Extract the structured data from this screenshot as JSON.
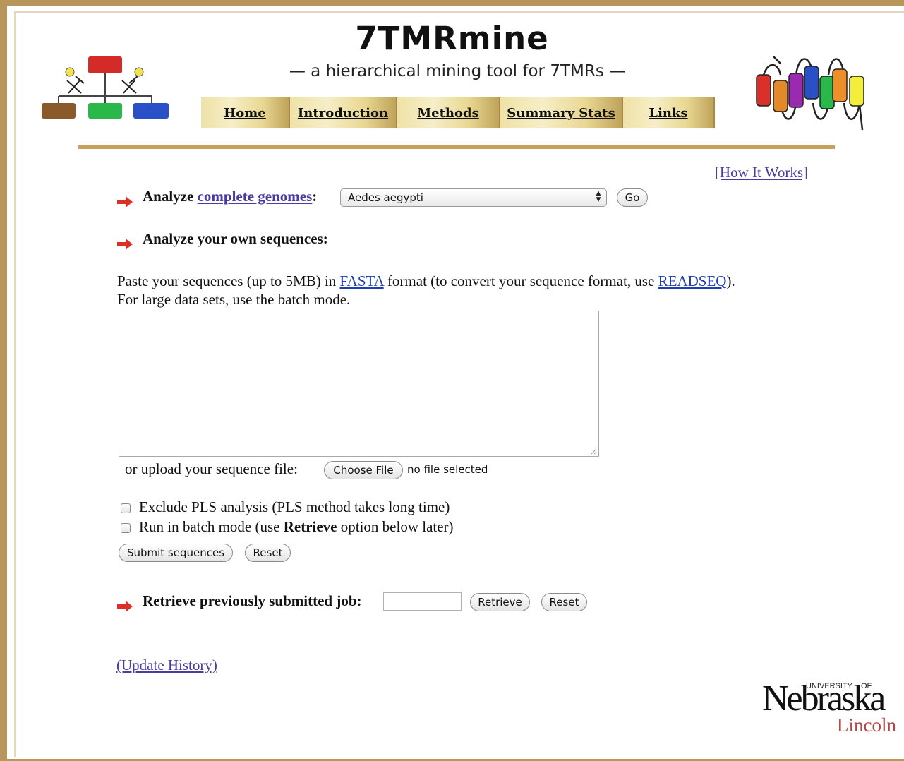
{
  "header": {
    "title": "7TMRmine",
    "subtitle": "— a hierarchical mining tool for 7TMRs —"
  },
  "nav": {
    "tabs": [
      {
        "label": "Home"
      },
      {
        "label": "Introduction"
      },
      {
        "label": "Methods"
      },
      {
        "label": "Summary Stats"
      },
      {
        "label": "Links"
      }
    ]
  },
  "how_it_works": "[How It Works]",
  "genomes": {
    "label_prefix": "Analyze ",
    "label_link": "complete genomes",
    "label_suffix": ":",
    "selected": "Aedes aegypti",
    "go_button": "Go"
  },
  "own_sequences": {
    "heading": "Analyze your own sequences:",
    "line1_a": "Paste your sequences (up to 5MB) in ",
    "fasta_link": "FASTA",
    "line1_b": " format (to convert your sequence format, use ",
    "readseq_link": "READSEQ",
    "line1_c": ").",
    "line2": "For large data sets, use the batch mode.",
    "textarea_value": "",
    "upload_label": "or upload your sequence file:",
    "choose_file_button": "Choose File",
    "no_file_text": "no file selected",
    "exclude_pls_label": "Exclude PLS analysis (PLS method takes long time)",
    "batch_label_a": "Run in batch mode (use ",
    "batch_label_bold": "Retrieve",
    "batch_label_b": " option below later)",
    "submit_button": "Submit sequences",
    "reset_button": "Reset"
  },
  "retrieve": {
    "label": "Retrieve previously submitted job:",
    "input_value": "",
    "retrieve_button": "Retrieve",
    "reset_button": "Reset"
  },
  "update_history": "(Update History)",
  "university_logo": {
    "university": "UNIVERSITY",
    "of": "OF",
    "name": "Nebraska",
    "campus": "Lincoln"
  },
  "colors": {
    "frame": "#b8955a",
    "link_purple": "#4b3aa0",
    "link_blue": "#1f3fb0",
    "arrow_red": "#d9312a",
    "lincoln_red": "#b8424a"
  },
  "icons": {
    "left_logo": "hierarchy-tree-icon",
    "right_logo": "seven-helix-receptor-icon",
    "bullet": "red-arrow-icon"
  }
}
